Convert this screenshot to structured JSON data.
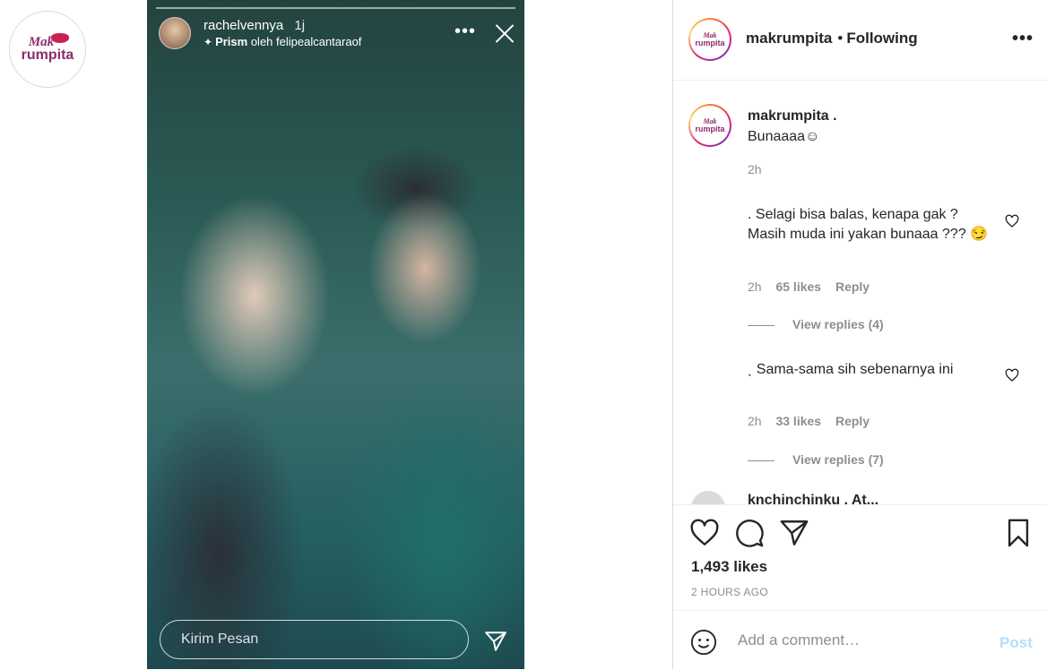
{
  "brand": {
    "mak": "Mak",
    "rumpita": "rumpita"
  },
  "story": {
    "username": "rachelvennya",
    "time": "1j",
    "sub_prefix": "Prism",
    "sub_suffix": "oleh felipealcantaraof",
    "reply_placeholder": "Kirim Pesan"
  },
  "post": {
    "header": {
      "username": "makrumpita",
      "dot": "•",
      "follow": "Following"
    },
    "caption": {
      "username": "makrumpita .",
      "text": "Bunaaaa☺",
      "time": "2h"
    },
    "comments": [
      {
        "text": ". Selagi bisa balas, kenapa gak ? Masih muda ini yakan bunaaa ??? 😏",
        "time": "2h",
        "likes": "65 likes",
        "reply": "Reply",
        "view_replies": "View replies (4)"
      },
      {
        "text": "ˎ Sama-sama sih sebenarnya ini",
        "time": "2h",
        "likes": "33 likes",
        "reply": "Reply",
        "view_replies": "View replies (7)"
      }
    ],
    "partial_comment": "knchinchinku . At..."
  },
  "likes_total": "1,493 likes",
  "ago": "2 HOURS AGO",
  "add_comment": {
    "placeholder": "Add a comment…",
    "post": "Post"
  },
  "colors": {
    "brand": "#8e2a6e",
    "post_button": "#b2dffc",
    "meta": "#8e8e8e"
  }
}
